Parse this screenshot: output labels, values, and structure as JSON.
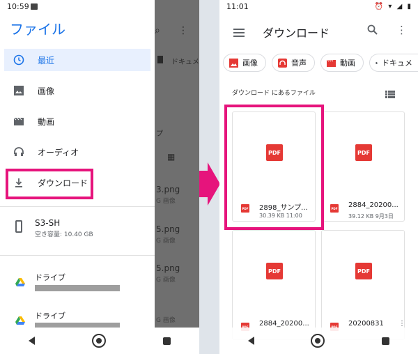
{
  "left": {
    "status": {
      "time": "10:59"
    },
    "drawer_title": "ファイル",
    "nav_items": [
      {
        "label": "最近",
        "icon": "clock-icon"
      },
      {
        "label": "画像",
        "icon": "image-icon"
      },
      {
        "label": "動画",
        "icon": "movie-icon"
      },
      {
        "label": "オーディオ",
        "icon": "headphones-icon"
      },
      {
        "label": "ダウンロード",
        "icon": "download-icon"
      }
    ],
    "device": {
      "name": "S3-SH",
      "free": "空き容量: 10.40 GB"
    },
    "drives": [
      {
        "label": "ドライブ"
      },
      {
        "label": "ドライブ"
      }
    ],
    "background": {
      "chip": "ドキュメ",
      "label_fragment": "プ",
      "files": [
        {
          "name": "3.png",
          "meta": "G 画像"
        },
        {
          "name": "5.png",
          "meta": "G 画像"
        },
        {
          "name": "5.png",
          "meta": "G 画像"
        },
        {
          "meta": "G 画像"
        }
      ]
    }
  },
  "right": {
    "status": {
      "time": "11:01"
    },
    "title": "ダウンロード",
    "chips": [
      {
        "label": "画像",
        "icon": "image-icon"
      },
      {
        "label": "音声",
        "icon": "headphones-icon"
      },
      {
        "label": "動画",
        "icon": "movie-icon"
      },
      {
        "label": "ドキュメ",
        "icon": "document-icon"
      }
    ],
    "section_label": "ダウンロード にあるファイル",
    "files": [
      {
        "name": "2898_サンプ...",
        "meta": "30.39 KB 11:00",
        "badge": "PDF"
      },
      {
        "name": "2884_20200...",
        "meta": "39.12 KB 9月3日",
        "badge": "PDF"
      },
      {
        "name": "2884_20200...",
        "meta": "",
        "badge": "PDF"
      },
      {
        "name": "20200831",
        "meta": "",
        "badge": "PDF"
      }
    ]
  },
  "colors": {
    "accent": "#1a73e8",
    "highlight": "#e6147c",
    "pdf": "#e53935"
  }
}
